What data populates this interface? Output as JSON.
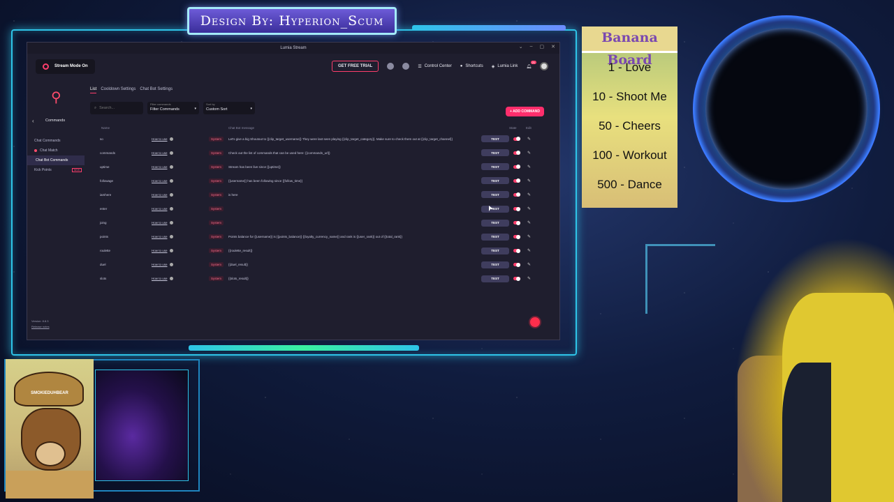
{
  "overlay": {
    "banner_text": "Design By: Hyperion_Scum"
  },
  "window": {
    "title": "Lumia Stream",
    "controls": [
      "⌄",
      "–",
      "▢",
      "✕"
    ]
  },
  "topbar": {
    "stream_mode_label": "Stream Mode On",
    "trial_label": "GET FREE TRIAL",
    "control_center": "Control Center",
    "shortcuts": "Shortcuts",
    "lumia_link": "Lumia Link",
    "notification_count": "21"
  },
  "sidebar": {
    "section_title": "Commands",
    "items": [
      {
        "label": "Chat Commands"
      },
      {
        "label": "Chat Match"
      },
      {
        "label": "Chat Bot Commands"
      },
      {
        "label": "Kick Points"
      }
    ],
    "kick_badge": "NEW",
    "version": "Version: 8.8.3",
    "release_notes": "Release notes"
  },
  "main": {
    "tabs": [
      {
        "label": "List"
      },
      {
        "label": "Cooldown Settings"
      },
      {
        "label": "Chat Bot Settings"
      }
    ],
    "search_placeholder": "Search...",
    "filter_label": "Filter commands",
    "filter_value": "Filter Commands",
    "sort_label": "Sort by",
    "sort_value": "Custom Sort",
    "add_button": "+ ADD COMMAND"
  },
  "table": {
    "headers": {
      "name": "Name",
      "message": "Chat Bot message",
      "state": "State",
      "edit": "Edit"
    },
    "how_label": "How to use",
    "system_label": "System",
    "test_label": "TEST",
    "rows": [
      {
        "name": "so",
        "message": "Let's give a big Shoutout to {{clip_target_username}} They were last seen playing {{clip_target_category}}. Make sure to check them out at {{clip_target_channel}}"
      },
      {
        "name": "commands",
        "message": "Check out the list of commands that can be used here: {{commands_url}}"
      },
      {
        "name": "uptime",
        "message": "Stream has been live since {{uptime}}"
      },
      {
        "name": "followage",
        "message": "{{username}} has been following since {{follow_time}}"
      },
      {
        "name": "iamhere",
        "message": "is here"
      },
      {
        "name": "enter",
        "message": ""
      },
      {
        "name": "joing",
        "message": ""
      },
      {
        "name": "points",
        "message": "Points balance for {{username}} is {{points_balance}} {{loyalty_currency_name}} and rank is {{user_rank}} out of {{total_rank}}"
      },
      {
        "name": "roulette",
        "message": "{{roulette_result}}"
      },
      {
        "name": "duel",
        "message": "{{duel_result}}"
      },
      {
        "name": "slots",
        "message": "{{slots_result}}"
      }
    ]
  },
  "banana_board": {
    "title": "Banana Board",
    "items": [
      "1 - Love",
      "10 - Shoot Me",
      "50 - Cheers",
      "100 - Workout",
      "500 - Dance"
    ]
  },
  "webcam": {
    "hat_text": "SMOKIEDUHBEAR"
  },
  "colors": {
    "accent": "#ff3e6c",
    "frame": "#2ec4e8"
  }
}
